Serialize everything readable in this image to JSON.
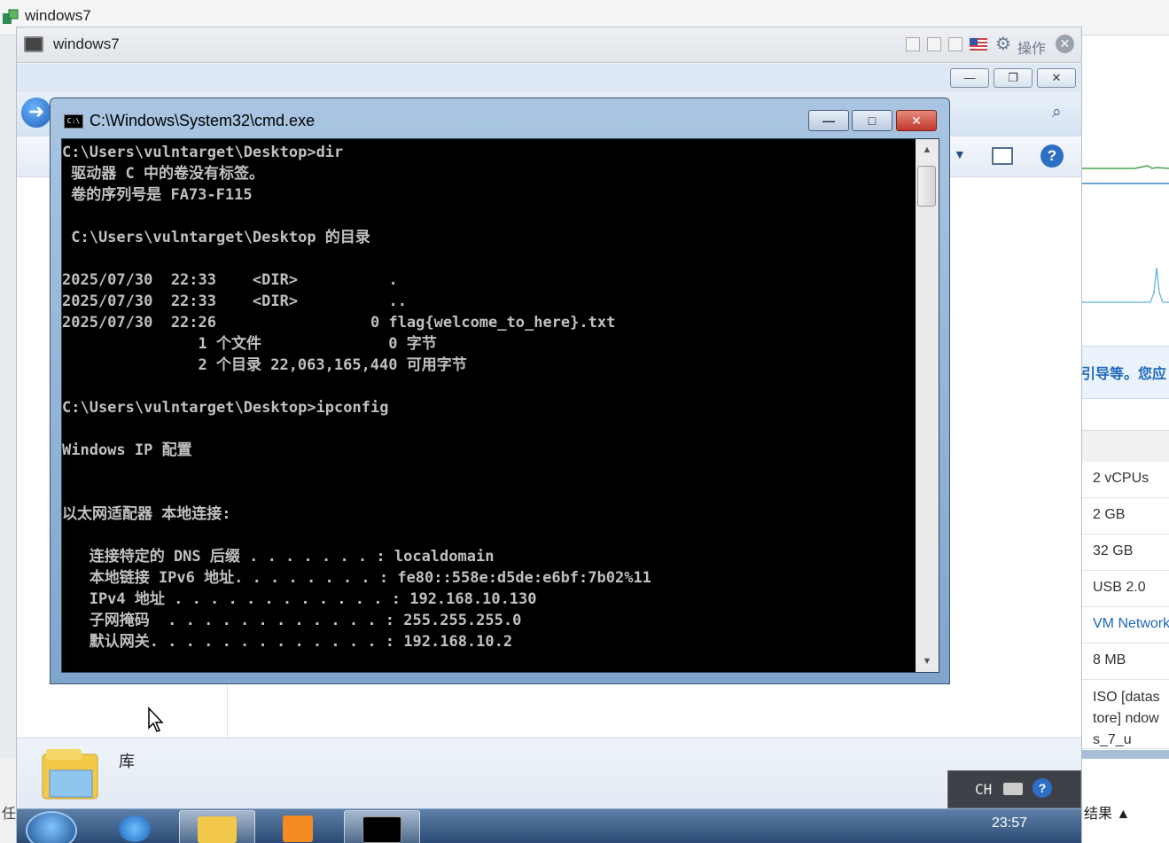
{
  "outer": {
    "title": "windows7"
  },
  "console": {
    "title": "windows7",
    "actions_label": "操作",
    "close_glyph": "✕",
    "gear_glyph": "⚙"
  },
  "guest_window_controls": {
    "min": "—",
    "restore": "❐",
    "close": "✕"
  },
  "explorer": {
    "back_glyph": "➜",
    "search_glyph": "⌕",
    "details_label": "库",
    "help_glyph": "?"
  },
  "cmd": {
    "title": "C:\\Windows\\System32\\cmd.exe",
    "icon_text": "C:\\",
    "buttons": {
      "min": "—",
      "max": "□",
      "close": "✕"
    },
    "lines": [
      "C:\\Users\\vulntarget\\Desktop>dir",
      " 驱动器 C 中的卷没有标签。",
      " 卷的序列号是 FA73-F115",
      "",
      " C:\\Users\\vulntarget\\Desktop 的目录",
      "",
      "2025/07/30  22:33    <DIR>          .",
      "2025/07/30  22:33    <DIR>          ..",
      "2025/07/30  22:26                 0 flag{welcome_to_here}.txt",
      "               1 个文件              0 字节",
      "               2 个目录 22,063,165,440 可用字节",
      "",
      "C:\\Users\\vulntarget\\Desktop>ipconfig",
      "",
      "Windows IP 配置",
      "",
      "",
      "以太网适配器 本地连接:",
      "",
      "   连接特定的 DNS 后缀 . . . . . . . : localdomain",
      "   本地链接 IPv6 地址. . . . . . . . : fe80::558e:d5de:e6bf:7b02%11",
      "   IPv4 地址 . . . . . . . . . . . . : 192.168.10.130",
      "   子网掩码  . . . . . . . . . . . . : 255.255.255.0",
      "   默认网关. . . . . . . . . . . . . : 192.168.10.2"
    ]
  },
  "side_panel": {
    "notice": "引导等。您应",
    "rows": [
      "2 vCPUs",
      "2 GB",
      "32 GB",
      "USB 2.0",
      "VM Network",
      "8 MB",
      "ISO [datastore] ndows_7_u"
    ],
    "results_label": "结果 ▲",
    "left_label": "任"
  },
  "taskbar": {
    "clock": "23:57",
    "lang": "CH",
    "help": "?"
  },
  "colors": {
    "cmd_bg": "#000000",
    "cmd_fg": "#c0c0c0",
    "link": "#1e6ab8"
  }
}
